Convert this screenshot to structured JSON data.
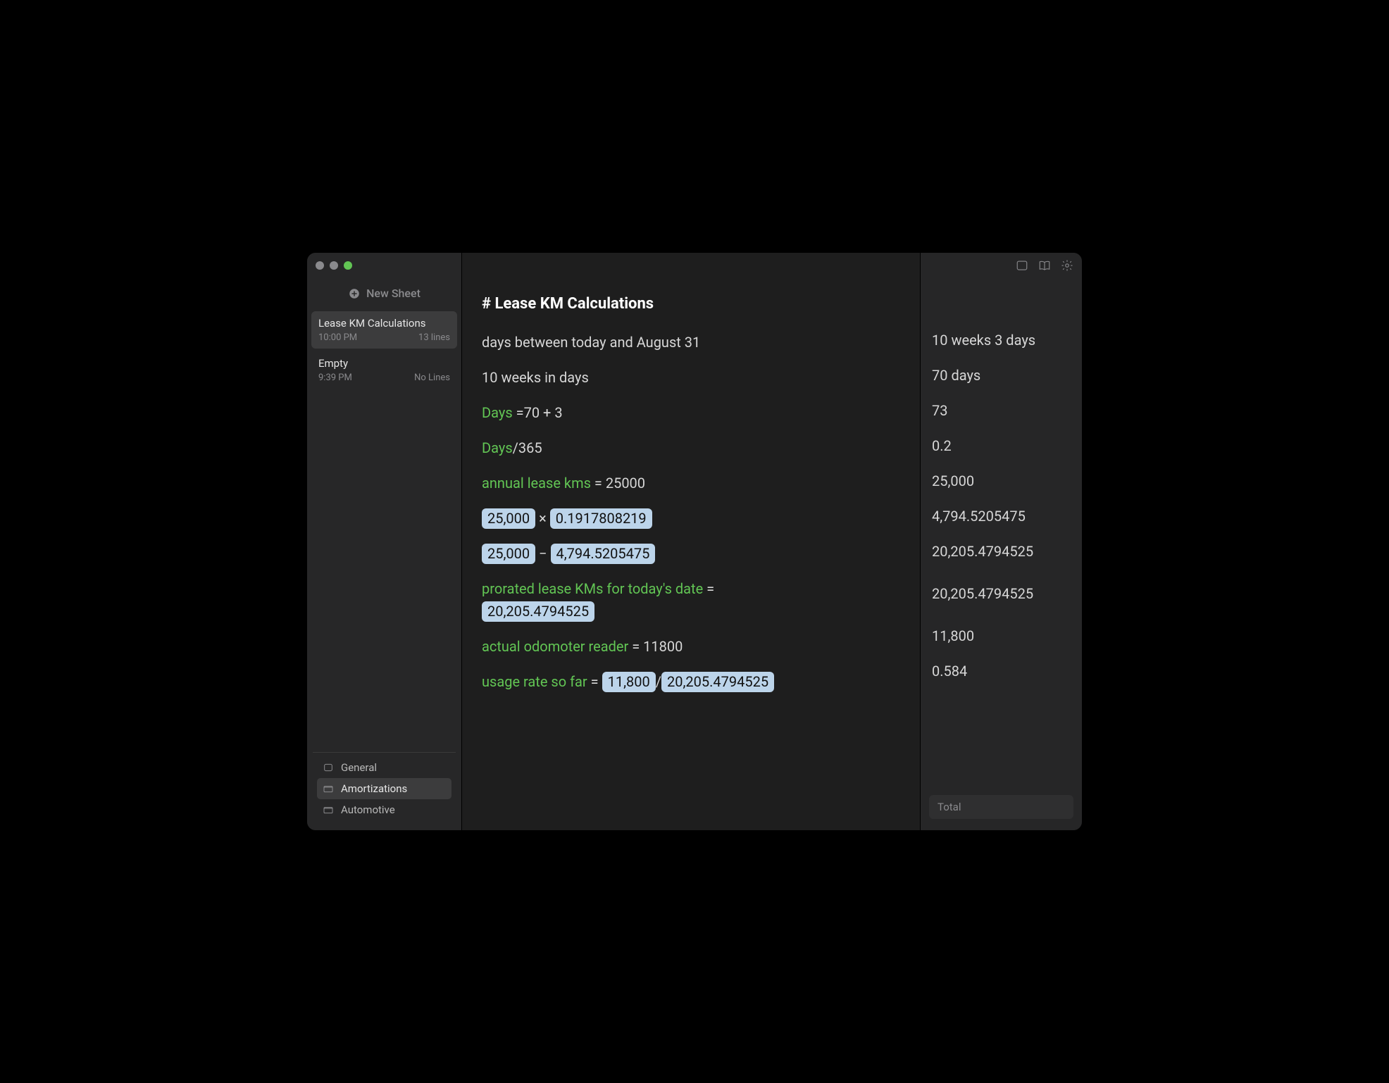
{
  "titlebar": {
    "icons": [
      "panel-icon",
      "book-icon",
      "gear-icon"
    ]
  },
  "sidebar": {
    "new_sheet_label": "New Sheet",
    "sheets": [
      {
        "title": "Lease KM Calculations",
        "time": "10:00 PM",
        "lines": "13 lines",
        "active": true
      },
      {
        "title": "Empty",
        "time": "9:39 PM",
        "lines": "No Lines",
        "active": false
      }
    ],
    "folders": [
      {
        "label": "General",
        "active": false,
        "icon": "rect"
      },
      {
        "label": "Amortizations",
        "active": true,
        "icon": "folder"
      },
      {
        "label": "Automotive",
        "active": false,
        "icon": "folder"
      }
    ]
  },
  "editor": {
    "heading": "# Lease KM Calculations",
    "lines": [
      {
        "tokens": [
          {
            "t": "plain",
            "v": "days between today and August 31"
          }
        ]
      },
      {
        "tokens": [
          {
            "t": "plain",
            "v": "10 weeks in days"
          }
        ]
      },
      {
        "tokens": [
          {
            "t": "green",
            "v": "Days "
          },
          {
            "t": "plain",
            "v": "=70 + 3"
          }
        ]
      },
      {
        "tokens": [
          {
            "t": "green",
            "v": "Days"
          },
          {
            "t": "plain",
            "v": "/365"
          }
        ]
      },
      {
        "tokens": [
          {
            "t": "green",
            "v": "annual lease kms"
          },
          {
            "t": "plain",
            "v": " = 25000"
          }
        ]
      },
      {
        "tokens": [
          {
            "t": "box",
            "v": "25,000"
          },
          {
            "t": "op",
            "v": " × "
          },
          {
            "t": "box",
            "v": "0.1917808219"
          }
        ]
      },
      {
        "tokens": [
          {
            "t": "box",
            "v": "25,000"
          },
          {
            "t": "op",
            "v": " − "
          },
          {
            "t": "box",
            "v": "4,794.5205475"
          }
        ]
      },
      {
        "double": true,
        "tokens": [
          {
            "t": "green",
            "v": "prorated lease KMs for today's date"
          },
          {
            "t": "plain",
            "v": " = "
          },
          {
            "t": "br"
          },
          {
            "t": "box",
            "v": "20,205.4794525"
          }
        ]
      },
      {
        "tokens": [
          {
            "t": "green",
            "v": "actual odomoter reader"
          },
          {
            "t": "plain",
            "v": " = 11800"
          }
        ]
      },
      {
        "tokens": [
          {
            "t": "green",
            "v": "usage rate so far"
          },
          {
            "t": "plain",
            "v": " = "
          },
          {
            "t": "box",
            "v": "11,800"
          },
          {
            "t": "op",
            "v": "/"
          },
          {
            "t": "box",
            "v": "20,205.4794525"
          }
        ]
      }
    ]
  },
  "results": {
    "values": [
      {
        "v": "10 weeks 3 days"
      },
      {
        "v": "70 days"
      },
      {
        "v": "73"
      },
      {
        "v": "0.2"
      },
      {
        "v": "25,000"
      },
      {
        "v": "4,794.5205475"
      },
      {
        "v": "20,205.4794525"
      },
      {
        "v": "20,205.4794525",
        "double": true
      },
      {
        "v": "11,800"
      },
      {
        "v": "0.584"
      }
    ],
    "total_label": "Total"
  }
}
